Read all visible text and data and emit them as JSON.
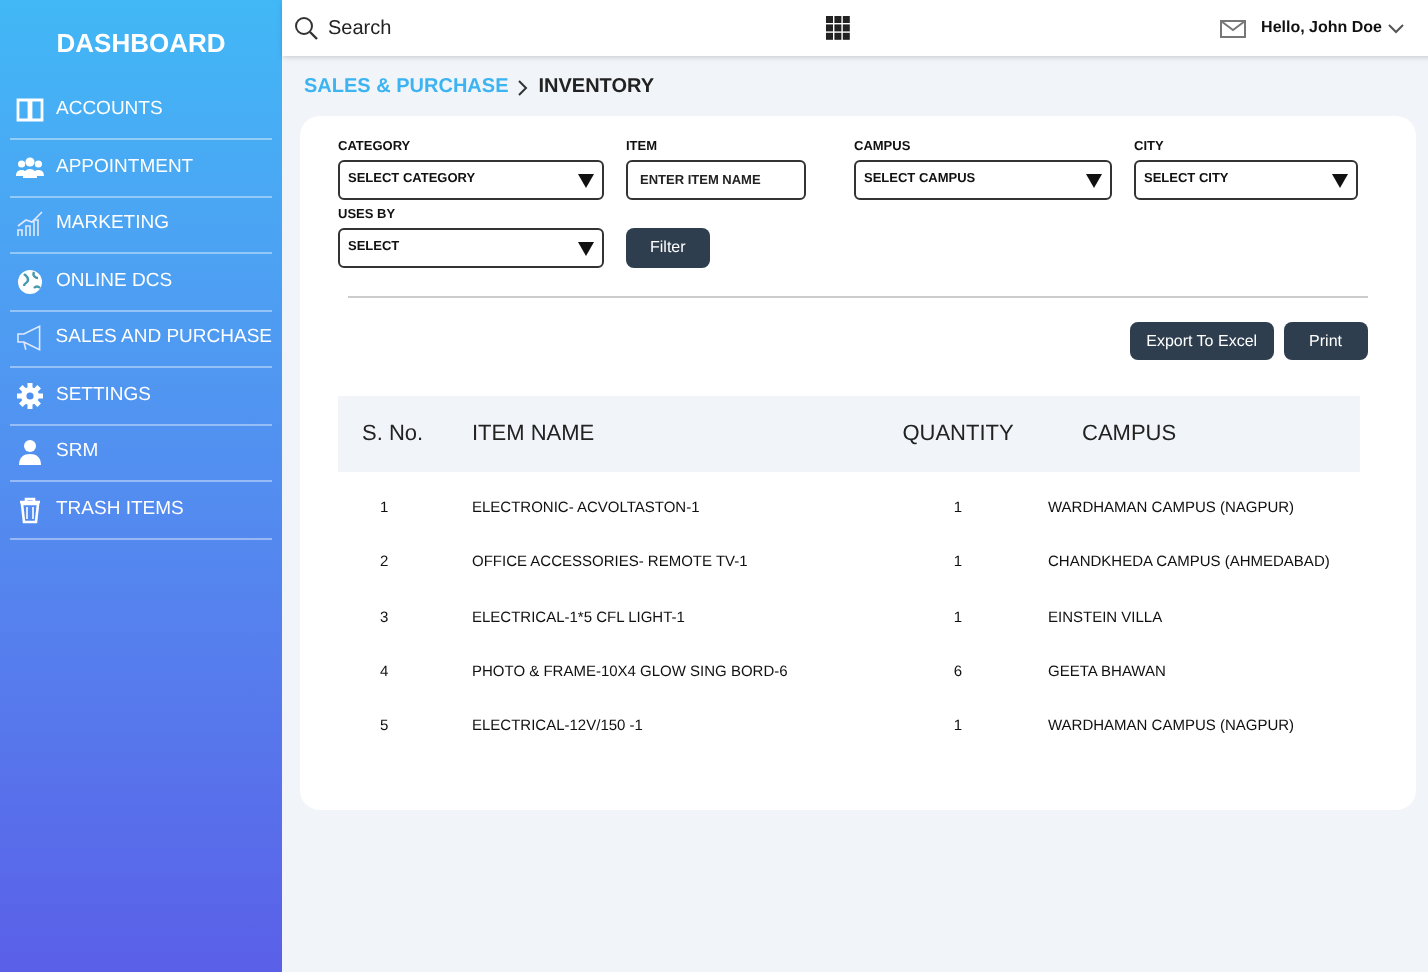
{
  "sidebar": {
    "title": "DASHBOARD",
    "items": [
      {
        "label": "ACCOUNTS"
      },
      {
        "label": "APPOINTMENT"
      },
      {
        "label": "MARKETING"
      },
      {
        "label": "ONLINE DCS"
      },
      {
        "label": "SALES AND PURCHASE"
      },
      {
        "label": "SETTINGS"
      },
      {
        "label": "SRM"
      },
      {
        "label": "TRASH ITEMS"
      }
    ]
  },
  "topbar": {
    "search": {
      "placeholder": "Search"
    },
    "user": "Hello, John Doe"
  },
  "breadcrumb": [
    {
      "label": "SALES & PURCHASE"
    },
    {
      "label": "INVENTORY"
    }
  ],
  "filters": [
    {
      "kind": "select",
      "label": "CATEGORY",
      "value": "SELECT CATEGORY"
    },
    {
      "kind": "input",
      "label": "ITEM",
      "placeholder": "ENTER ITEM NAME"
    },
    {
      "kind": "select",
      "label": "CAMPUS",
      "value": "SELECT CAMPUS"
    },
    {
      "kind": "select",
      "label": "CITY",
      "value": "SELECT CITY"
    },
    {
      "kind": "select",
      "label": "USES BY",
      "value": "SELECT"
    }
  ],
  "filter_button": "Filter",
  "actions": [
    "Export To Excel",
    "Print"
  ],
  "table": {
    "columns": [
      "S. No.",
      "ITEM NAME",
      "QUANTITY",
      "CAMPUS"
    ],
    "rows": [
      [
        "1",
        "ELECTRONIC- ACVOLTASTON-1",
        "1",
        "WARDHAMAN CAMPUS (NAGPUR)"
      ],
      [
        "2",
        "OFFICE ACCESSORIES- REMOTE TV-1",
        "1",
        "CHANDKHEDA CAMPUS (AHMEDABAD)"
      ],
      [
        "3",
        "ELECTRICAL-1*5 CFL LIGHT-1",
        "1",
        "EINSTEIN VILLA"
      ],
      [
        "4",
        "PHOTO & FRAME-10X4 GLOW SING BORD-6",
        "6",
        "GEETA BHAWAN"
      ],
      [
        "5",
        "ELECTRICAL-12V/150 -1",
        "1",
        "WARDHAMAN CAMPUS (NAGPUR)"
      ]
    ]
  }
}
